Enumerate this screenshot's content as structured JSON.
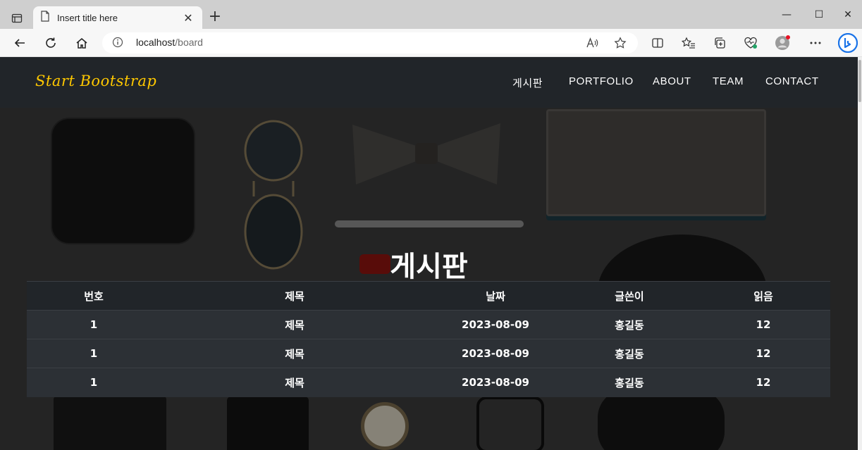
{
  "browser": {
    "tab_title": "Insert title here",
    "tab_close": "✕",
    "new_tab": "+",
    "address_host": "localhost",
    "address_path": "/board",
    "window_controls": {
      "minimize": "—",
      "maximize": "☐",
      "close": "✕"
    }
  },
  "site": {
    "brand": "Start Bootstrap",
    "brand_color": "#ffc800",
    "nav": [
      {
        "label": "게시판"
      },
      {
        "label": "PORTFOLIO"
      },
      {
        "label": "ABOUT"
      },
      {
        "label": "TEAM"
      },
      {
        "label": "CONTACT"
      }
    ]
  },
  "board": {
    "title": "게시판",
    "columns": [
      "번호",
      "제목",
      "날짜",
      "글쓴이",
      "읽음"
    ],
    "rows": [
      [
        "1",
        "제목",
        "2023-08-09",
        "홍길동",
        "12"
      ],
      [
        "1",
        "제목",
        "2023-08-09",
        "홍길동",
        "12"
      ],
      [
        "1",
        "제목",
        "2023-08-09",
        "홍길동",
        "12"
      ]
    ]
  }
}
